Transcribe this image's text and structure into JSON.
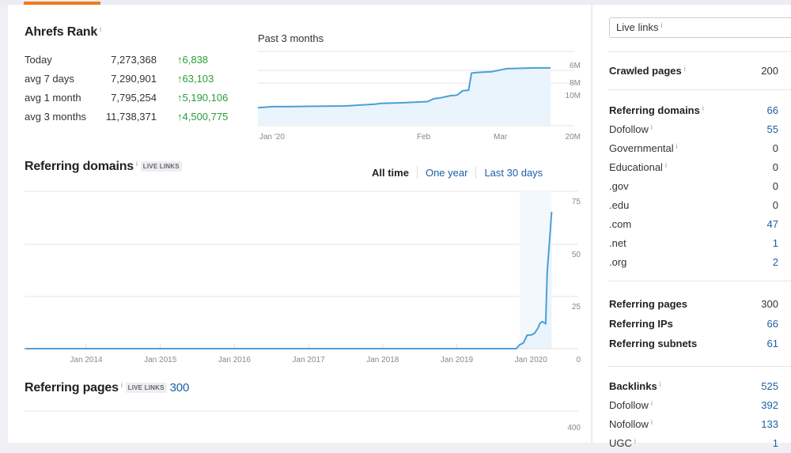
{
  "colors": {
    "accent": "#f07b16",
    "link": "#1d5fa5",
    "positive": "#2a9d3a",
    "chart_line": "#4a9fd8",
    "chart_fill": "#eaf4fc"
  },
  "ahrefs_rank": {
    "title": "Ahrefs Rank",
    "info": "i",
    "rows": [
      {
        "label": "Today",
        "value": "7,273,368",
        "change": "↑6,838"
      },
      {
        "label": "avg 7 days",
        "value": "7,290,901",
        "change": "↑63,103"
      },
      {
        "label": "avg 1 month",
        "value": "7,795,254",
        "change": "↑5,190,106"
      },
      {
        "label": "avg 3 months",
        "value": "11,738,371",
        "change": "↑4,500,775"
      }
    ],
    "period_label": "Past 3 months"
  },
  "referring_domains": {
    "title": "Referring domains",
    "info": "i",
    "badge": "LIVE LINKS",
    "tabs": [
      {
        "label": "All time",
        "active": true
      },
      {
        "label": "One year",
        "active": false
      },
      {
        "label": "Last 30 days",
        "active": false
      }
    ]
  },
  "referring_pages": {
    "title": "Referring pages",
    "info": "i",
    "badge": "LIVE LINKS",
    "count": "300"
  },
  "chart_data": [
    {
      "type": "area",
      "title": "Past 3 months",
      "ylabel": "Ahrefs Rank",
      "y_inverted": true,
      "x_ticks": [
        "Jan '20",
        "Feb",
        "Mar"
      ],
      "y_ticks": [
        "6M",
        "8M",
        "10M",
        "20M"
      ],
      "x": [
        0,
        5,
        10,
        20,
        30,
        40,
        42,
        50,
        58,
        60,
        62,
        66,
        68,
        70,
        72,
        73,
        75,
        80,
        85,
        90,
        95,
        100
      ],
      "values": [
        13.6,
        13.3,
        13.3,
        13.2,
        13.1,
        12.6,
        12.4,
        12.2,
        11.9,
        11.1,
        10.9,
        10.2,
        10.1,
        9.4,
        9.3,
        6.9,
        6.8,
        6.7,
        6.3,
        6.25,
        6.2,
        6.2
      ],
      "x_range": "Jan 2020 - Mar 2020"
    },
    {
      "type": "area",
      "title": "Referring domains",
      "x_ticks": [
        "Jan 2014",
        "Jan 2015",
        "Jan 2016",
        "Jan 2017",
        "Jan 2018",
        "Jan 2019",
        "Jan 2020"
      ],
      "y_ticks": [
        "0",
        "25",
        "50",
        "75"
      ],
      "ylim": [
        0,
        75
      ],
      "x": [
        2013.2,
        2019.0,
        2019.8,
        2019.85,
        2019.9,
        2019.95,
        2020.0,
        2020.05,
        2020.1,
        2020.12,
        2020.15,
        2020.2,
        2020.22,
        2020.25,
        2020.28
      ],
      "values": [
        0,
        0,
        0,
        2,
        3,
        7,
        7,
        8,
        11,
        13,
        14,
        13,
        40,
        55,
        71
      ]
    },
    {
      "type": "area",
      "title": "Referring pages",
      "y_ticks": [
        "400"
      ],
      "values": []
    }
  ],
  "side": {
    "select_value": "Live links",
    "select_info": "i",
    "crawled_pages": {
      "label": "Crawled pages",
      "value": "200"
    },
    "domains": [
      {
        "label": "Referring domains",
        "value": "66",
        "bold": true,
        "link": true,
        "info": true
      },
      {
        "label": "Dofollow",
        "value": "55",
        "bold": false,
        "link": true,
        "info": true
      },
      {
        "label": "Governmental",
        "value": "0",
        "bold": false,
        "link": false,
        "info": true
      },
      {
        "label": "Educational",
        "value": "0",
        "bold": false,
        "link": false,
        "info": true
      },
      {
        "label": ".gov",
        "value": "0",
        "bold": false,
        "link": false,
        "info": false
      },
      {
        "label": ".edu",
        "value": "0",
        "bold": false,
        "link": false,
        "info": false
      },
      {
        "label": ".com",
        "value": "47",
        "bold": false,
        "link": true,
        "info": false
      },
      {
        "label": ".net",
        "value": "1",
        "bold": false,
        "link": true,
        "info": false
      },
      {
        "label": ".org",
        "value": "2",
        "bold": false,
        "link": true,
        "info": false
      }
    ],
    "refs": [
      {
        "label": "Referring pages",
        "value": "300",
        "link": false
      },
      {
        "label": "Referring IPs",
        "value": "66",
        "link": true
      },
      {
        "label": "Referring subnets",
        "value": "61",
        "link": true
      }
    ],
    "backlinks": [
      {
        "label": "Backlinks",
        "value": "525",
        "bold": true,
        "info": true
      },
      {
        "label": "Dofollow",
        "value": "392",
        "bold": false,
        "info": true
      },
      {
        "label": "Nofollow",
        "value": "133",
        "bold": false,
        "info": true
      },
      {
        "label": "UGC",
        "value": "1",
        "bold": false,
        "info": true
      }
    ]
  }
}
